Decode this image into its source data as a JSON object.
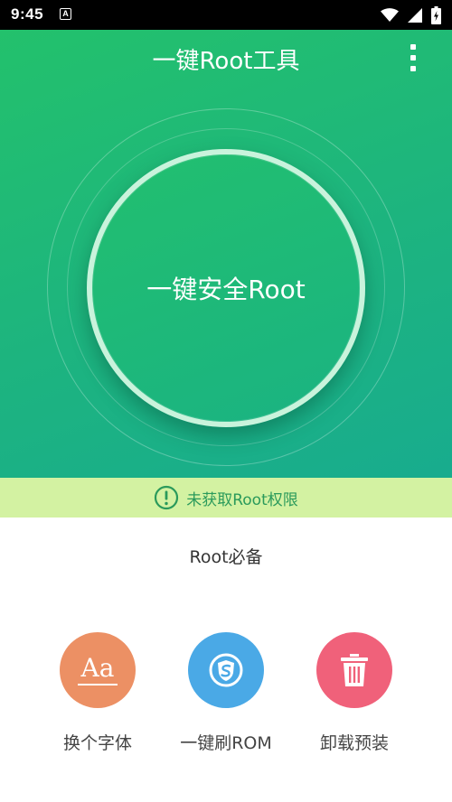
{
  "status_bar": {
    "time": "9:45",
    "notification_icon": "A",
    "icons": [
      "wifi-icon",
      "signal-icon",
      "battery-icon"
    ]
  },
  "header": {
    "title": "一键Root工具",
    "menu_icon": "more-vert-icon"
  },
  "hero": {
    "button_label": "一键安全Root",
    "colors": {
      "gradient_start": "#23c16c",
      "gradient_end": "#18ac8e",
      "ring": "#c9f3dc"
    }
  },
  "notice": {
    "icon": "alert-circle-icon",
    "text": "未获取Root权限",
    "background": "#d3f2a2",
    "color": "#2a9a5b"
  },
  "essentials": {
    "title": "Root必备",
    "tools": [
      {
        "label": "换个字体",
        "icon": "font-icon",
        "icon_text": "Aa",
        "color": "#ec9064"
      },
      {
        "label": "一键刷ROM",
        "icon": "shield-s-icon",
        "color": "#4aa9e6"
      },
      {
        "label": "卸载预装",
        "icon": "trash-icon",
        "color": "#f0617a"
      }
    ]
  }
}
